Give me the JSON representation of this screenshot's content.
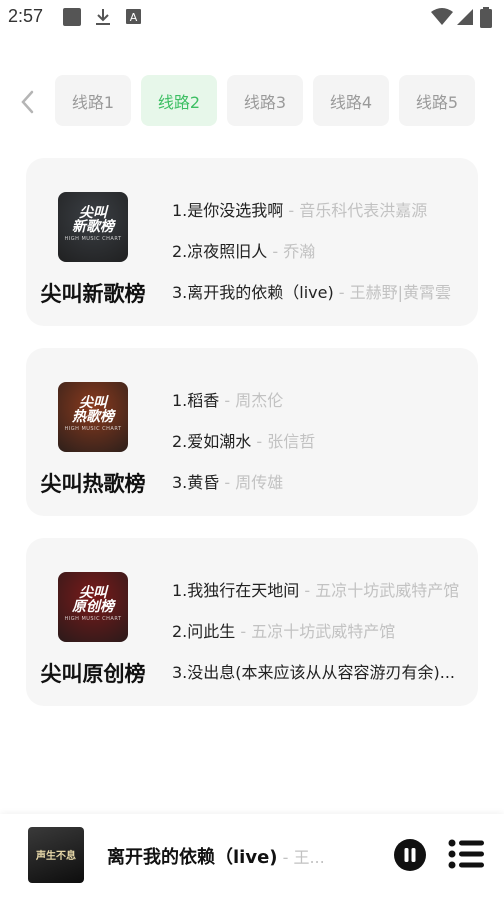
{
  "status_bar": {
    "time": "2:57",
    "icons": [
      "square-app-icon",
      "download-icon",
      "a-badge-icon",
      "wifi-icon",
      "signal-icon",
      "battery-icon"
    ]
  },
  "routes": {
    "tabs": [
      {
        "label": "线路1",
        "active": false
      },
      {
        "label": "线路2",
        "active": true
      },
      {
        "label": "线路3",
        "active": false
      },
      {
        "label": "线路4",
        "active": false
      },
      {
        "label": "线路5",
        "active": false
      }
    ]
  },
  "charts": [
    {
      "title": "尖叫新歌榜",
      "cover_text": "尖叫\n新歌榜",
      "cover_sub": "HIGH MUSIC CHART",
      "cover_color": "#3b3f44",
      "songs": [
        {
          "name": "1.是你没选我啊",
          "artist": " - 音乐科代表洪嘉源"
        },
        {
          "name": "2.凉夜照旧人",
          "artist": " - 乔瀚"
        },
        {
          "name": "3.离开我的依赖（live)",
          "artist": " - 王赫野|黄霄雲"
        }
      ]
    },
    {
      "title": "尖叫热歌榜",
      "cover_text": "尖叫\n热歌榜",
      "cover_sub": "HIGH MUSIC CHART",
      "cover_color": "#8a3a1e",
      "songs": [
        {
          "name": "1.稻香",
          "artist": " - 周杰伦"
        },
        {
          "name": "2.爱如潮水",
          "artist": " - 张信哲"
        },
        {
          "name": "3.黄昏",
          "artist": " - 周传雄"
        }
      ]
    },
    {
      "title": "尖叫原创榜",
      "cover_text": "尖叫\n原创榜",
      "cover_sub": "HIGH MUSIC CHART",
      "cover_color": "#7a1a1a",
      "songs": [
        {
          "name": "1.我独行在天地间",
          "artist": " - 五凉十坊武威特产馆"
        },
        {
          "name": "2.问此生",
          "artist": " - 五凉十坊武威特产馆"
        },
        {
          "name": "3.没出息(本来应该从从容容游刃有余)...",
          "artist": ""
        }
      ]
    }
  ],
  "player": {
    "cover_text": "声生不息",
    "title": "离开我的依赖（live)",
    "artist": " - 王..."
  }
}
